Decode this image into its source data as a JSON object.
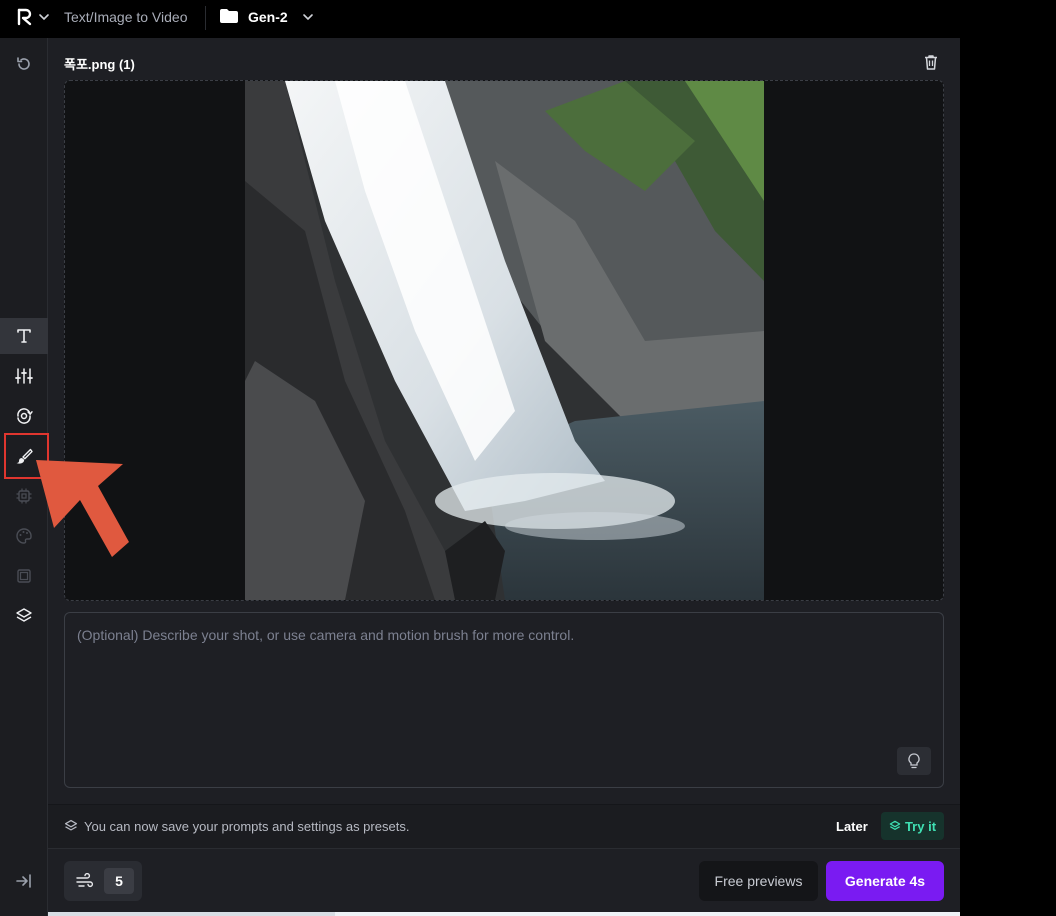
{
  "topbar": {
    "breadcrumb": "Text/Image to Video",
    "project": "Gen-2"
  },
  "rail": {
    "items": [
      {
        "name": "history",
        "icon": "history-icon"
      },
      {
        "name": "text",
        "icon": "text-icon",
        "active": true
      },
      {
        "name": "settings",
        "icon": "sliders-icon"
      },
      {
        "name": "camera-motion",
        "icon": "camera-motion-icon"
      },
      {
        "name": "motion-brush",
        "icon": "brush-icon",
        "highlighted": true
      },
      {
        "name": "model",
        "icon": "chip-icon"
      },
      {
        "name": "style",
        "icon": "palette-icon"
      },
      {
        "name": "aspect",
        "icon": "frame-icon"
      },
      {
        "name": "presets",
        "icon": "layers-icon"
      },
      {
        "name": "collapse",
        "icon": "collapse-icon"
      }
    ]
  },
  "media": {
    "file_name": "폭포.png (1)"
  },
  "prompt": {
    "value": "",
    "placeholder": "(Optional) Describe your shot, or use camera and motion brush for more control."
  },
  "preset_banner": {
    "text": "You can now save your prompts and settings as presets.",
    "later_label": "Later",
    "try_label": "Try it"
  },
  "footer": {
    "motion_value": "5",
    "free_previews_label": "Free previews",
    "generate_label": "Generate 4s"
  },
  "colors": {
    "accent": "#7a1bf2",
    "highlight": "#e0362f",
    "arrow": "#e0593f",
    "try_text": "#3fe0b3"
  }
}
